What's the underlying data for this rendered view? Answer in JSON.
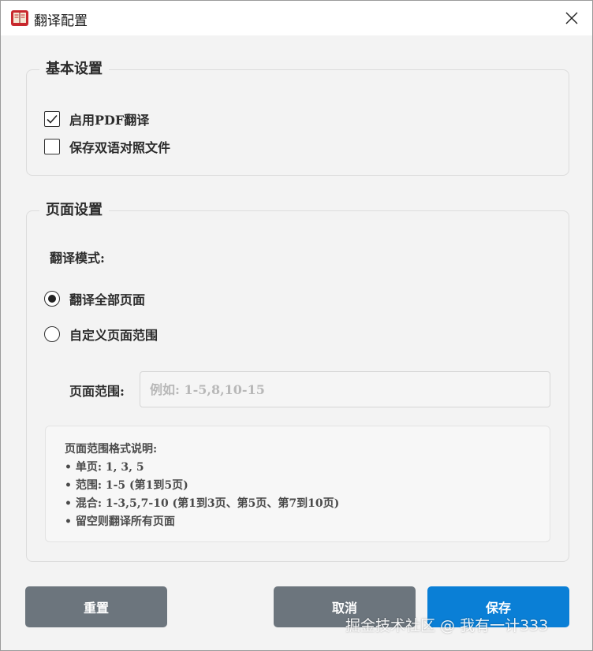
{
  "window": {
    "title": "翻译配置",
    "app_icon": "book-icon",
    "close_icon": "close-icon"
  },
  "basic_settings": {
    "title": "基本设置",
    "options": [
      {
        "label": "启用PDF翻译",
        "checked": true
      },
      {
        "label": "保存双语对照文件",
        "checked": false
      }
    ]
  },
  "page_settings": {
    "title": "页面设置",
    "mode_label": "翻译模式:",
    "modes": [
      {
        "label": "翻译全部页面",
        "selected": true
      },
      {
        "label": "自定义页面范围",
        "selected": false
      }
    ],
    "range_label": "页面范围:",
    "range_value": "",
    "range_placeholder": "例如: 1-5,8,10-15",
    "help": {
      "title": "页面范围格式说明:",
      "lines": [
        "• 单页: 1, 3, 5",
        "• 范围: 1-5 (第1到5页)",
        "• 混合: 1-3,5,7-10 (第1到3页、第5页、第7到10页)",
        "• 留空则翻译所有页面"
      ]
    }
  },
  "buttons": {
    "reset": "重置",
    "cancel": "取消",
    "save": "保存"
  },
  "colors": {
    "save": "#0a7fd6",
    "secondary": "#6c757d"
  },
  "watermark": "掘金技术社区 @ 我有一计333"
}
